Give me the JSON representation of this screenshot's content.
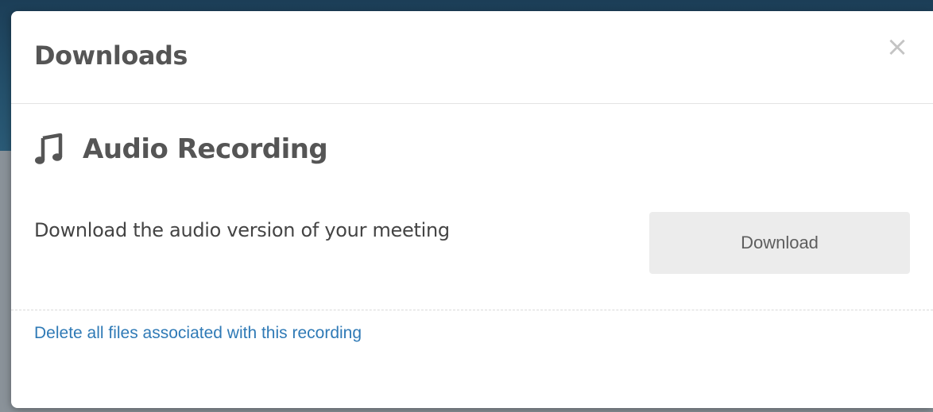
{
  "modal": {
    "title": "Downloads",
    "close_glyph": "×",
    "close_icon": "close-icon"
  },
  "section": {
    "icon": "music-note-icon",
    "title": "Audio Recording",
    "description": "Download the audio version of your meeting",
    "download_label": "Download"
  },
  "footer": {
    "delete_link": "Delete all files associated with this recording"
  },
  "colors": {
    "title_text": "#555555",
    "link": "#2f7ab6",
    "button_bg": "#ececec",
    "backdrop_top": "#1c3e57"
  }
}
